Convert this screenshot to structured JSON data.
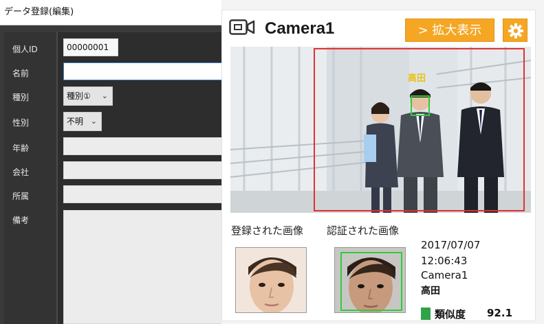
{
  "form": {
    "title": "データ登録(編集)",
    "fields": {
      "id": {
        "label": "個人ID",
        "value": "00000001"
      },
      "name": {
        "label": "名前",
        "value": ""
      },
      "type": {
        "label": "種別",
        "value": "種別①"
      },
      "gender": {
        "label": "性別",
        "value": "不明"
      },
      "age": {
        "label": "年齢",
        "value": ""
      },
      "company": {
        "label": "会社",
        "value": ""
      },
      "department": {
        "label": "所属",
        "value": ""
      },
      "notes": {
        "label": "備考",
        "value": ""
      }
    }
  },
  "camera": {
    "title": "Camera1",
    "expand_label": "> 拡大表示",
    "detected_name": "高田",
    "registered_label": "登録された画像",
    "authenticated_label": "認証された画像",
    "event": {
      "date": "2017/07/07",
      "time": "12:06:43",
      "camera": "Camera1",
      "name": "高田",
      "similarity_label": "類似度",
      "similarity_value": "92.1"
    },
    "colors": {
      "accent": "#f5a623",
      "detect": "#e23030",
      "face": "#2ecc40",
      "ok": "#2ea34a"
    }
  }
}
